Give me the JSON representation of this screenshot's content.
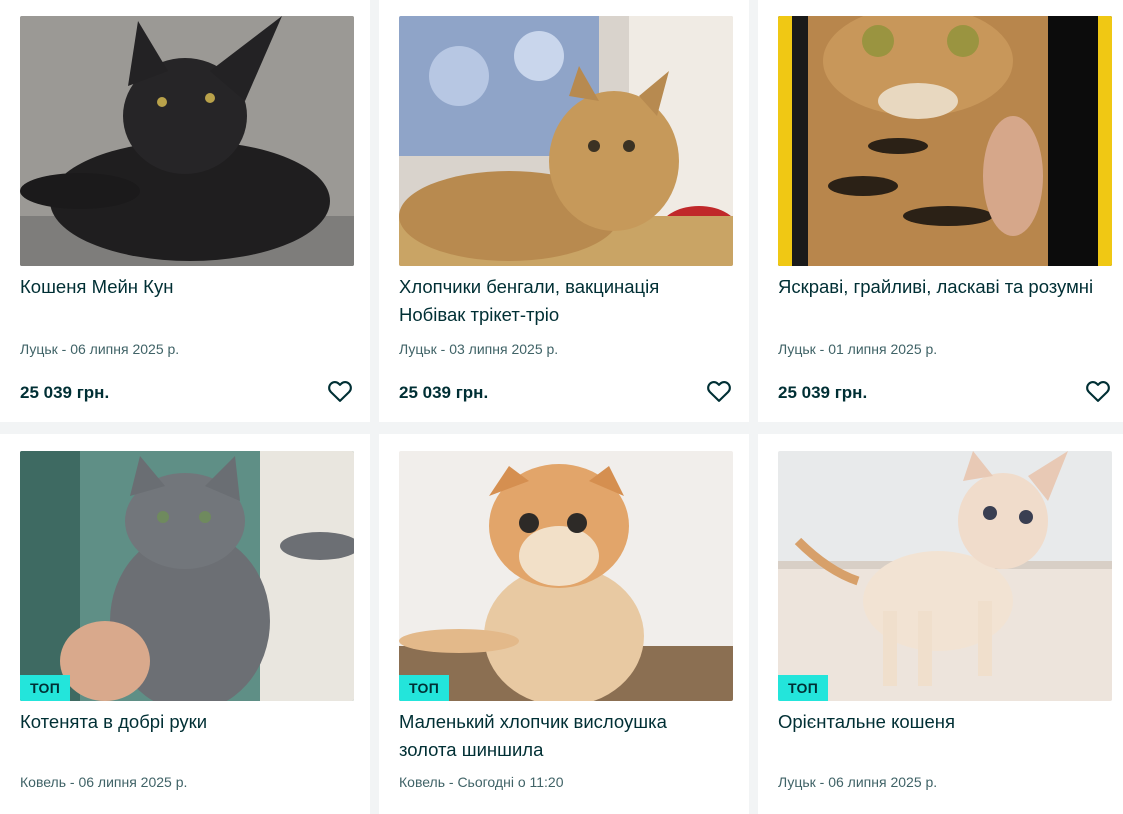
{
  "listings": [
    {
      "title": "Кошеня Мейн Кун",
      "meta": "Луцьк - 06 липня 2025 р.",
      "price": "25 039 грн.",
      "top": "",
      "image": "black-maine-coon-kitten"
    },
    {
      "title": "Хлопчики бенгали, вакцинація Нобівак трікет-тріо",
      "meta": "Луцьк - 03 липня 2025 р.",
      "price": "25 039 грн.",
      "top": "",
      "image": "bengal-kitten-on-pillow"
    },
    {
      "title": "Яскраві, грайливі, ласкаві та розумні",
      "meta": "Луцьк - 01 липня 2025 р.",
      "price": "25 039 грн.",
      "top": "",
      "image": "bengal-kitten-held"
    },
    {
      "title": "Котенята в добрі руки",
      "meta": "Ковель - 06 липня 2025 р.",
      "price": "",
      "top": "ТОП",
      "image": "grey-kitten-held"
    },
    {
      "title": "Маленький хлопчик вислоушка золота шиншила",
      "meta": "Ковель - Сьогодні о 11:20",
      "price": "",
      "top": "ТОП",
      "image": "golden-fold-kitten"
    },
    {
      "title": "Орієнтальне кошеня",
      "meta": "Луцьк - 06 липня 2025 р.",
      "price": "",
      "top": "ТОП",
      "image": "oriental-kitten"
    }
  ],
  "colors": {
    "background": "#f2f4f5",
    "card": "#ffffff",
    "text": "#002f34",
    "muted": "#406367",
    "top_badge": "#23e5db"
  },
  "icons": {
    "favorite": "heart-outline-icon"
  }
}
